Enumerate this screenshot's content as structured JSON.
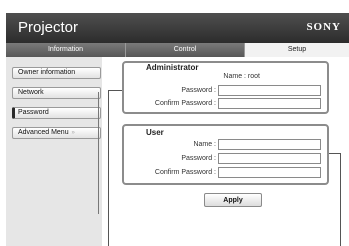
{
  "header": {
    "title": "Projector",
    "brand": "SONY"
  },
  "tabs": [
    {
      "label": "Information"
    },
    {
      "label": "Control"
    },
    {
      "label": "Setup"
    }
  ],
  "sidebar": {
    "items": [
      {
        "label": "Owner information"
      },
      {
        "label": "Network"
      },
      {
        "label": "Password"
      },
      {
        "label": "Advanced Menu",
        "chevron": "»"
      }
    ]
  },
  "administrator": {
    "title": "Administrator",
    "name_label": "Name : root",
    "password_label": "Password :",
    "confirm_label": "Confirm Password :",
    "password_value": "",
    "confirm_value": ""
  },
  "user": {
    "title": "User",
    "name_label": "Name :",
    "password_label": "Password :",
    "confirm_label": "Confirm Password :",
    "name_value": "",
    "password_value": "",
    "confirm_value": ""
  },
  "apply_label": "Apply"
}
